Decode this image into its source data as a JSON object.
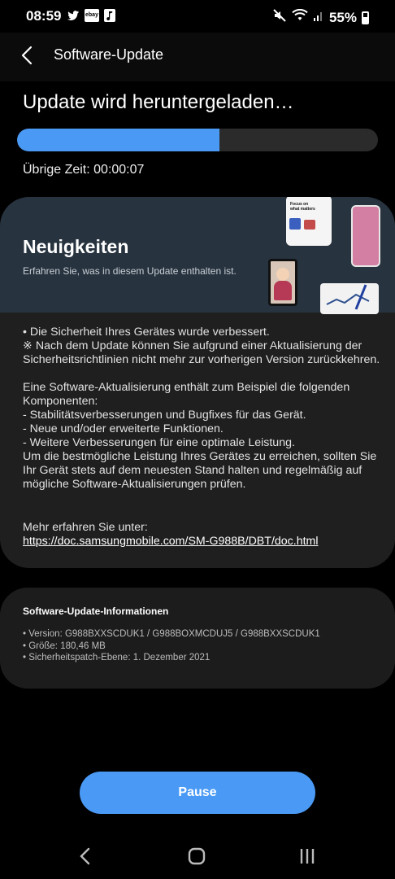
{
  "status_bar": {
    "time": "08:59",
    "notification_icons": [
      "twitter-icon",
      "ebay-icon",
      "music-icon"
    ],
    "ebay_label": "ebay",
    "system_icons": [
      "mute-icon",
      "wifi-icon",
      "signal-icon",
      "battery-icon"
    ],
    "battery": "55%"
  },
  "header": {
    "title": "Software-Update"
  },
  "download": {
    "heading": "Update wird heruntergeladen…",
    "progress": 0.56,
    "remaining_time": "Übrige Zeit: 00:00:07"
  },
  "news": {
    "title": "Neuigkeiten",
    "subtitle": "Erfahren Sie, was in diesem Update enthalten ist.",
    "phone_mock_text": "Focus on what matters",
    "paragraph1": "• Die Sicherheit Ihres Gerätes wurde verbessert.\n※ Nach dem Update können Sie aufgrund einer Aktualisierung der Sicherheitsrichtlinien nicht mehr zur vorherigen Version zurückkehren.",
    "paragraph2": "Eine Software-Aktualisierung enthält zum Beispiel die folgenden Komponenten:\n - Stabilitätsverbesserungen und Bugfixes für das Gerät.\n - Neue und/oder erweiterte Funktionen.\n - Weitere Verbesserungen für eine optimale Leistung.\nUm die bestmögliche Leistung Ihres Gerätes zu erreichen, sollten Sie Ihr Gerät stets auf dem neuesten Stand halten und regelmäßig auf mögliche Software-Aktualisierungen prüfen.",
    "more_label": "Mehr erfahren Sie unter:",
    "link": "https://doc.samsungmobile.com/SM-G988B/DBT/doc.html"
  },
  "info": {
    "title": "Software-Update-Informationen",
    "items": [
      "• Version: G988BXXSCDUK1 / G988BOXMCDUJ5 / G988BXXSCDUK1",
      "• Größe: 180,46 MB",
      "• Sicherheitspatch-Ebene: 1. Dezember 2021"
    ]
  },
  "actions": {
    "pause_label": "Pause"
  },
  "colors": {
    "accent": "#4a9af5",
    "background": "#000000",
    "card": "#1f1f1f",
    "banner": "#27333f"
  }
}
